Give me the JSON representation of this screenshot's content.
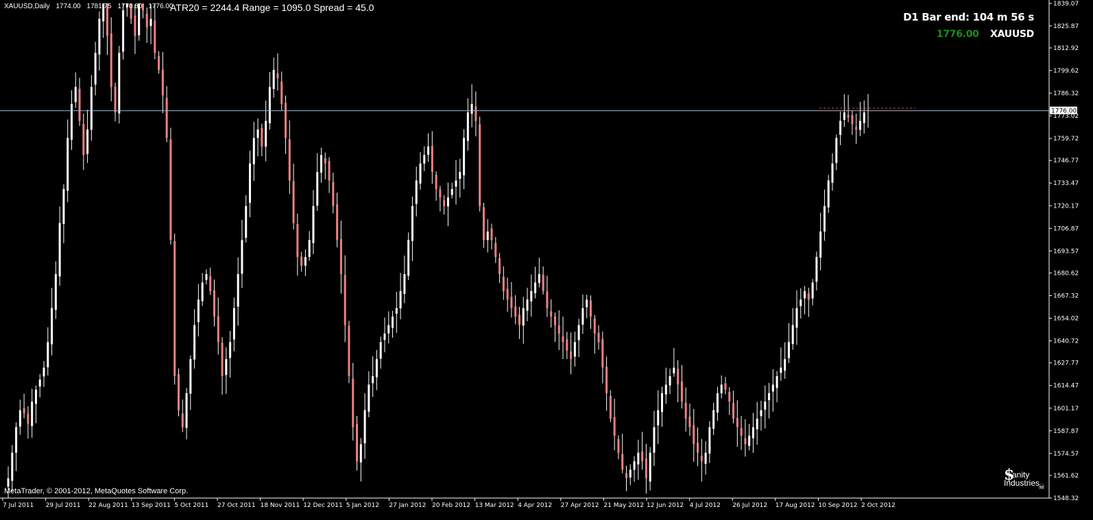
{
  "symbol_info": {
    "symbol": "XAUUSD,Daily",
    "open": "1774.00",
    "high": "1781.75",
    "low": "1770.80",
    "close": "1776.00"
  },
  "indicator_text": "ATR20 = 2244.4 Range = 1095.0 Spread = 45.0",
  "timer_text": "D1 Bar end: 104 m 56 s",
  "price_badge": {
    "price": "1776.00",
    "symbol": "XAUUSD"
  },
  "copyright": "MetaTrader, © 2001-2012, MetaQuotes Software Corp.",
  "logo": {
    "line1": "anity",
    "line2": "Industries"
  },
  "current_price_label": "1776.00",
  "colors": {
    "background": "#000000",
    "bull": "#ffffff",
    "bear": "#f08080",
    "grid_line": "#a0b4c8",
    "price_green": "#1e8c1e",
    "level_line": "#e04040"
  },
  "chart_data": {
    "type": "candlestick",
    "ylim": [
      1548.32,
      1839.07
    ],
    "y_ticks": [
      "1839.07",
      "1825.87",
      "1812.92",
      "1799.62",
      "1786.32",
      "1773.02",
      "1759.72",
      "1746.77",
      "1733.47",
      "1720.17",
      "1706.87",
      "1693.57",
      "1680.62",
      "1667.32",
      "1654.02",
      "1640.72",
      "1627.77",
      "1614.47",
      "1601.17",
      "1587.87",
      "1574.57",
      "1561.62",
      "1548.32"
    ],
    "x_ticks": [
      "7 Jul 2011",
      "29 Jul 2011",
      "22 Aug 2011",
      "13 Sep 2011",
      "5 Oct 2011",
      "27 Oct 2011",
      "18 Nov 2011",
      "12 Dec 2011",
      "5 Jan 2012",
      "27 Jan 2012",
      "20 Feb 2012",
      "13 Mar 2012",
      "4 Apr 2012",
      "27 Apr 2012",
      "21 May 2012",
      "12 Jun 2012",
      "4 Jul 2012",
      "26 Jul 2012",
      "17 Aug 2012",
      "10 Sep 2012",
      "2 Oct 2012"
    ],
    "current_price": 1776.0,
    "resistance_level": 1777.5,
    "close_series": [
      1560,
      1575,
      1590,
      1600,
      1598,
      1592,
      1605,
      1612,
      1618,
      1625,
      1640,
      1660,
      1680,
      1710,
      1730,
      1760,
      1780,
      1790,
      1770,
      1750,
      1765,
      1790,
      1810,
      1830,
      1839,
      1820,
      1790,
      1775,
      1810,
      1835,
      1839,
      1830,
      1820,
      1839,
      1835,
      1825,
      1830,
      1810,
      1800,
      1785,
      1760,
      1700,
      1620,
      1600,
      1590,
      1610,
      1630,
      1650,
      1665,
      1675,
      1680,
      1670,
      1655,
      1640,
      1620,
      1630,
      1640,
      1660,
      1680,
      1700,
      1720,
      1745,
      1760,
      1765,
      1755,
      1770,
      1790,
      1800,
      1795,
      1780,
      1760,
      1735,
      1710,
      1690,
      1685,
      1690,
      1700,
      1720,
      1740,
      1750,
      1745,
      1735,
      1720,
      1700,
      1680,
      1650,
      1620,
      1590,
      1570,
      1580,
      1600,
      1615,
      1620,
      1630,
      1640,
      1645,
      1650,
      1655,
      1660,
      1670,
      1680,
      1700,
      1720,
      1735,
      1745,
      1750,
      1755,
      1740,
      1730,
      1725,
      1720,
      1725,
      1730,
      1735,
      1740,
      1760,
      1775,
      1780,
      1770,
      1720,
      1700,
      1705,
      1700,
      1690,
      1680,
      1670,
      1665,
      1660,
      1655,
      1650,
      1660,
      1665,
      1670,
      1675,
      1680,
      1670,
      1660,
      1655,
      1650,
      1645,
      1640,
      1635,
      1630,
      1640,
      1650,
      1660,
      1665,
      1655,
      1645,
      1640,
      1625,
      1610,
      1595,
      1585,
      1575,
      1565,
      1560,
      1565,
      1570,
      1575,
      1570,
      1560,
      1575,
      1590,
      1600,
      1610,
      1615,
      1620,
      1625,
      1615,
      1605,
      1595,
      1590,
      1580,
      1575,
      1570,
      1575,
      1590,
      1600,
      1610,
      1615,
      1612,
      1605,
      1595,
      1590,
      1585,
      1580,
      1585,
      1590,
      1595,
      1600,
      1605,
      1610,
      1615,
      1620,
      1625,
      1630,
      1640,
      1650,
      1660,
      1665,
      1670,
      1665,
      1675,
      1690,
      1705,
      1720,
      1735,
      1745,
      1760,
      1770,
      1775,
      1772,
      1768,
      1765,
      1770,
      1775,
      1776
    ]
  }
}
